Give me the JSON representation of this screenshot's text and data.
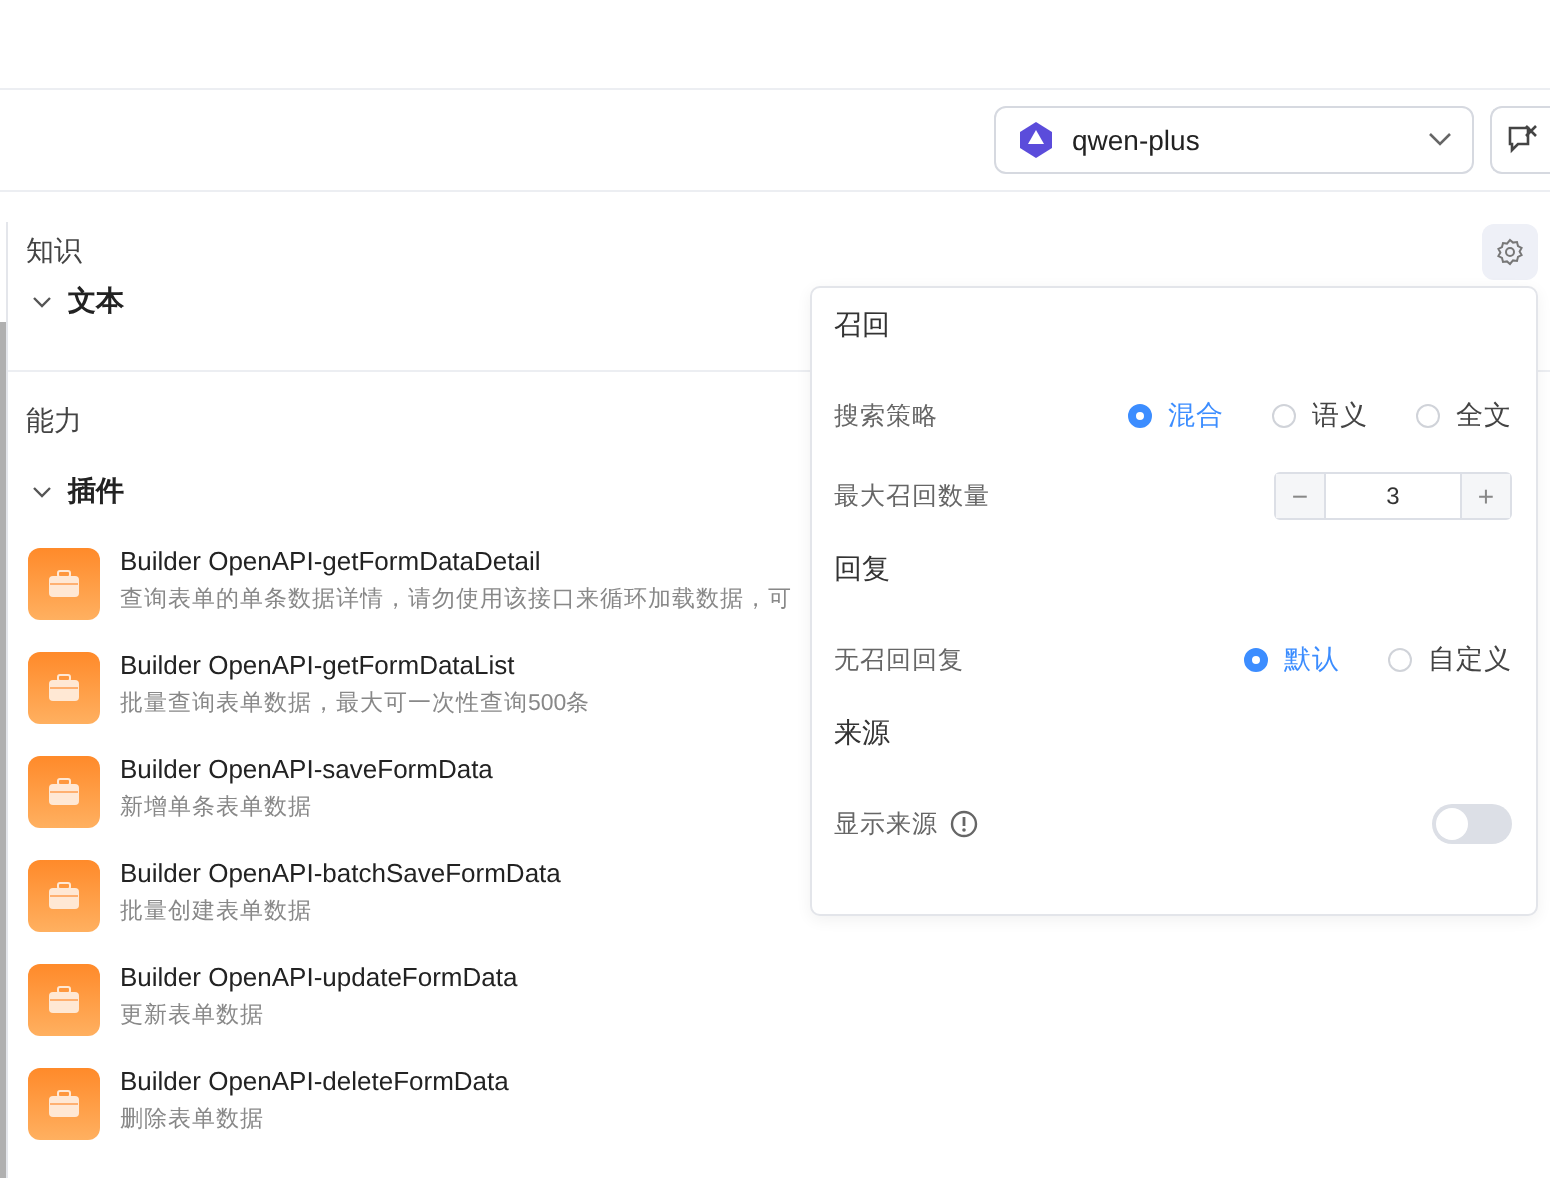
{
  "model_select": {
    "value": "qwen-plus"
  },
  "knowledge": {
    "title": "知识",
    "sections": [
      {
        "label": "文本",
        "expanded": true
      }
    ]
  },
  "abilities": {
    "title": "能力",
    "sections": [
      {
        "label": "插件",
        "expanded": true
      }
    ]
  },
  "plugins": [
    {
      "name": "Builder OpenAPI-getFormDataDetail",
      "description": "查询表单的单条数据详情，请勿使用该接口来循环加载数据，可"
    },
    {
      "name": "Builder OpenAPI-getFormDataList",
      "description": "批量查询表单数据，最大可一次性查询500条"
    },
    {
      "name": "Builder OpenAPI-saveFormData",
      "description": "新增单条表单数据"
    },
    {
      "name": "Builder OpenAPI-batchSaveFormData",
      "description": "批量创建表单数据"
    },
    {
      "name": "Builder OpenAPI-updateFormData",
      "description": "更新表单数据"
    },
    {
      "name": "Builder OpenAPI-deleteFormData",
      "description": "删除表单数据"
    }
  ],
  "popover": {
    "sections": [
      {
        "title": "召回",
        "rows": [
          {
            "kind": "radio",
            "label": "搜索策略",
            "options": [
              {
                "label": "混合",
                "selected": true
              },
              {
                "label": "语义",
                "selected": false
              },
              {
                "label": "全文",
                "selected": false
              }
            ]
          },
          {
            "kind": "stepper",
            "label": "最大召回数量",
            "value": "3",
            "decrement": "−",
            "increment": "+"
          }
        ]
      },
      {
        "title": "回复",
        "rows": [
          {
            "kind": "radio",
            "label": "无召回回复",
            "options": [
              {
                "label": "默认",
                "selected": true
              },
              {
                "label": "自定义",
                "selected": false
              }
            ]
          }
        ]
      },
      {
        "title": "来源",
        "rows": [
          {
            "kind": "switch",
            "label": "显示来源",
            "on": false
          }
        ]
      }
    ]
  }
}
